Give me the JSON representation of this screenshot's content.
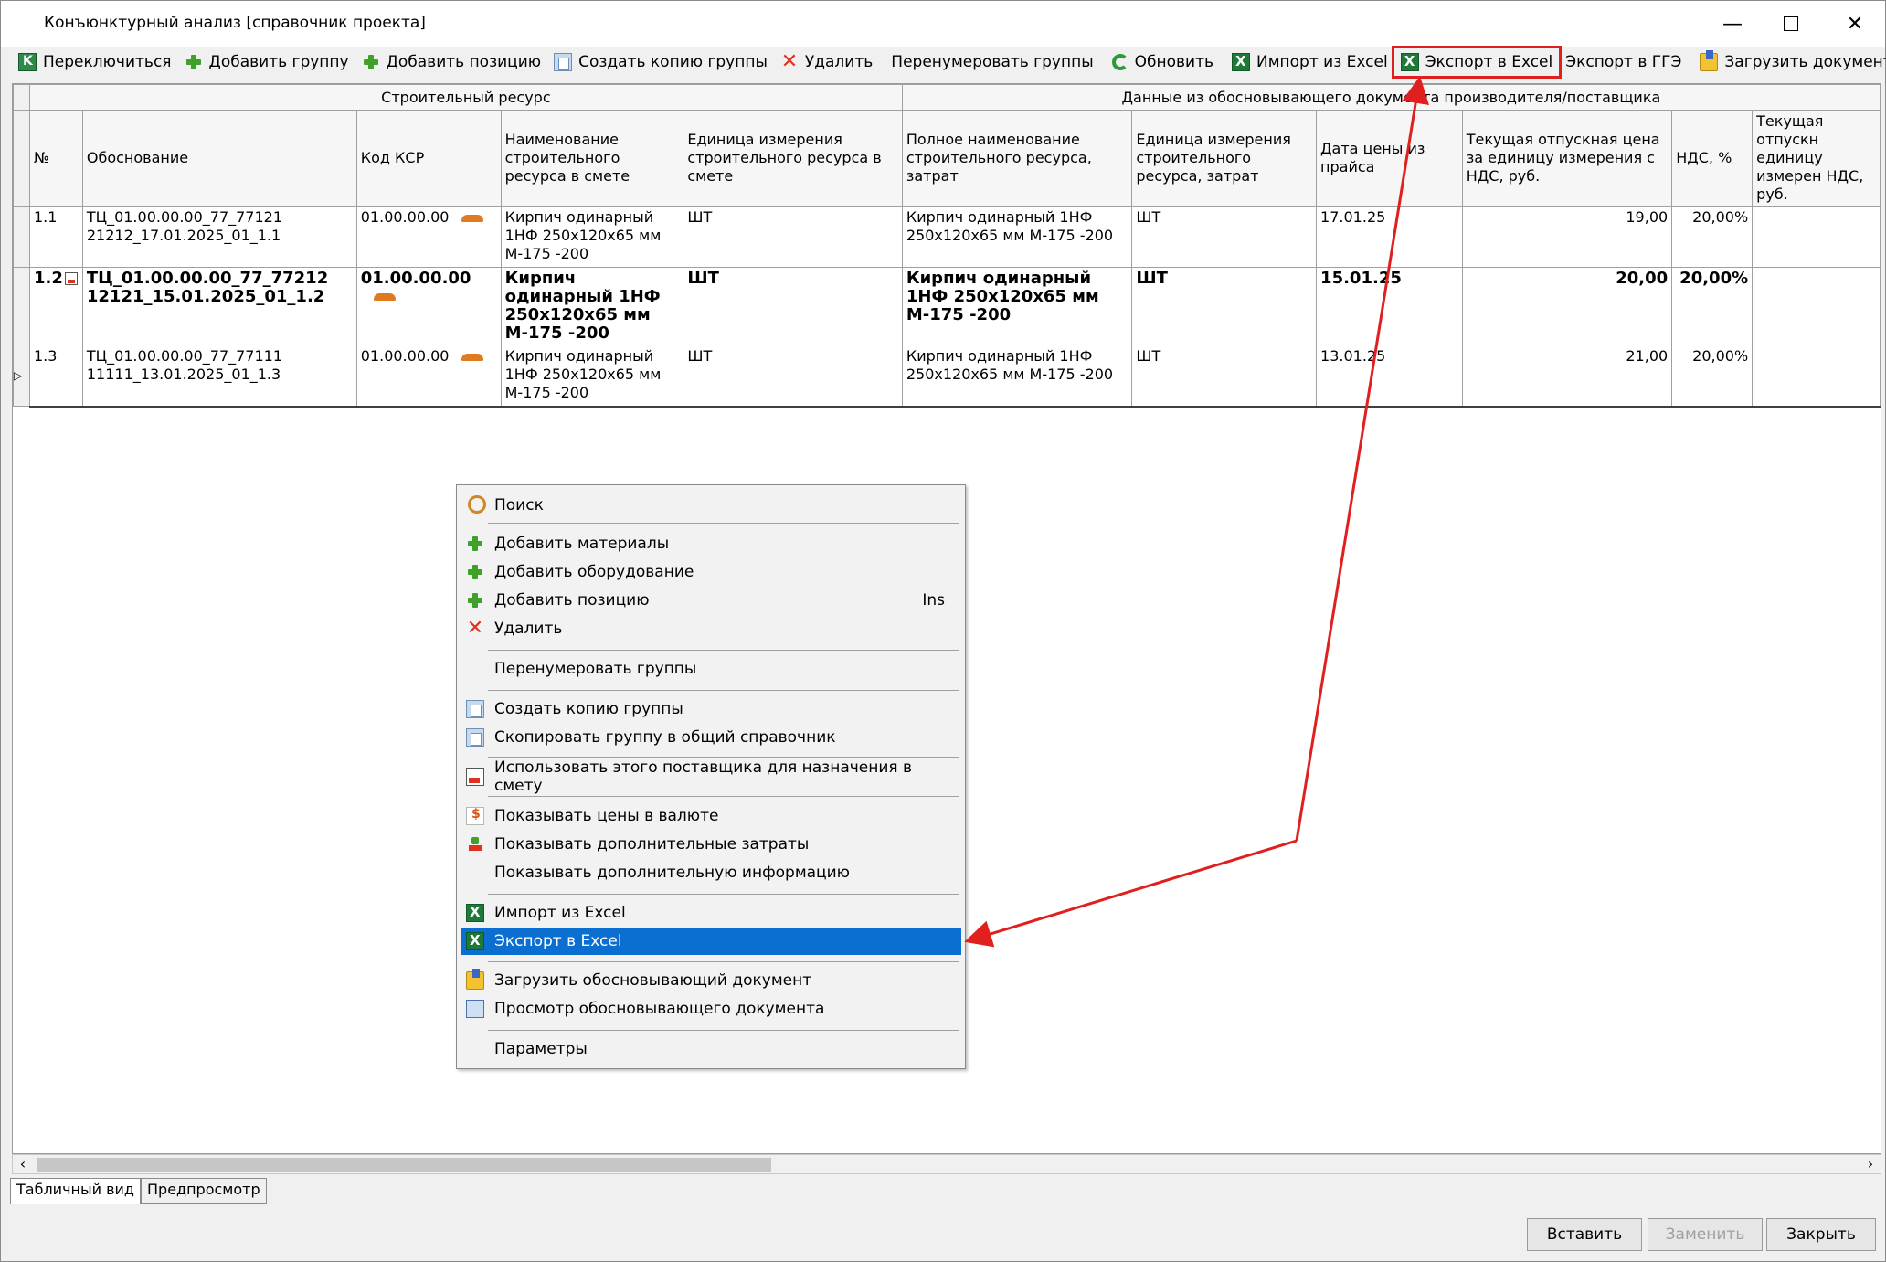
{
  "window": {
    "title": "Конъюнктурный анализ [справочник проекта]"
  },
  "toolbar": {
    "switch": "Переключиться",
    "add_group": "Добавить группу",
    "add_position": "Добавить позицию",
    "copy_group": "Создать копию группы",
    "delete": "Удалить",
    "renumber": "Перенумеровать группы",
    "refresh": "Обновить",
    "import_excel": "Импорт из Excel",
    "export_excel": "Экспорт в Excel",
    "export_gge": "Экспорт в ГГЭ",
    "load_doc": "Загрузить документ",
    "more": "»"
  },
  "grid": {
    "group_resource": "Строительный ресурс",
    "group_doc": "Данные из обосновывающего документа производителя/поставщика",
    "columns": [
      "№",
      "Обоснование",
      "Код КСР",
      "Наименование строительного ресурса в смете",
      "Единица измерения строительного ресурса в смете",
      "Полное наименование строительного ресурса, затрат",
      "Единица измерения строительного ресурса, затрат",
      "Дата цены из прайса",
      "Текущая отпускная цена за единицу измерения с НДС, руб.",
      "НДС, %",
      "Текущая отпускн единицу измерен НДС, руб."
    ],
    "rows": [
      {
        "num": "1.1",
        "basis": "ТЦ_01.00.00.00_77_77121 21212_17.01.2025_01_1.1",
        "ksr": "01.00.00.00",
        "name": "Кирпич одинарный 1НФ 250x120x65 мм М-175 -200",
        "unit": "ШТ",
        "full_name": "Кирпич одинарный 1НФ 250x120x65 мм М-175 -200",
        "unit2": "ШТ",
        "date": "17.01.25",
        "price": "19,00",
        "vat": "20,00%"
      },
      {
        "num": "1.2",
        "basis": "ТЦ_01.00.00.00_77_77212 12121_15.01.2025_01_1.2",
        "ksr": "01.00.00.00",
        "name": "Кирпич одинарный 1НФ 250x120x65 мм М-175 -200",
        "unit": "ШТ",
        "full_name": "Кирпич одинарный 1НФ 250x120x65 мм М-175 -200",
        "unit2": "ШТ",
        "date": "15.01.25",
        "price": "20,00",
        "vat": "20,00%"
      },
      {
        "num": "1.3",
        "basis": "ТЦ_01.00.00.00_77_77111 11111_13.01.2025_01_1.3",
        "ksr": "01.00.00.00",
        "name": "Кирпич одинарный 1НФ 250x120x65 мм М-175 -200",
        "unit": "ШТ",
        "full_name": "Кирпич одинарный 1НФ 250x120x65 мм М-175 -200",
        "unit2": "ШТ",
        "date": "13.01.25",
        "price": "21,00",
        "vat": "20,00%"
      }
    ]
  },
  "context_menu": {
    "search": "Поиск",
    "add_materials": "Добавить материалы",
    "add_equipment": "Добавить оборудование",
    "add_position": "Добавить позицию",
    "add_position_shortcut": "Ins",
    "delete": "Удалить",
    "renumber": "Перенумеровать группы",
    "copy_group": "Создать копию группы",
    "copy_to_common": "Скопировать группу в общий справочник",
    "use_supplier": "Использовать этого поставщика для назначения в смету",
    "show_currency": "Показывать цены в валюте",
    "show_extra_costs": "Показывать дополнительные затраты",
    "show_extra_info": "Показывать дополнительную информацию",
    "import_excel": "Импорт из Excel",
    "export_excel": "Экспорт в Excel",
    "load_basis_doc": "Загрузить обосновывающий документ",
    "view_basis_doc": "Просмотр обосновывающего документа",
    "params": "Параметры"
  },
  "tabs": {
    "table_view": "Табличный вид",
    "preview": "Предпросмотр"
  },
  "buttons": {
    "insert": "Вставить",
    "replace": "Заменить",
    "close": "Закрыть"
  },
  "colors": {
    "highlight": "#e0201e",
    "selection": "#0a6fd1"
  }
}
